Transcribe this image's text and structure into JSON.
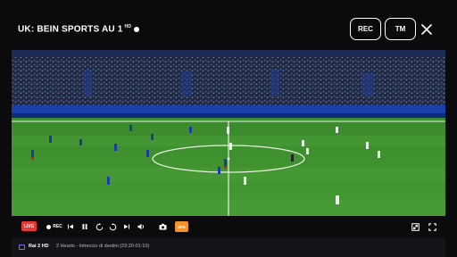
{
  "header": {
    "channel_title": "UK: BEIN SPORTS AU 1",
    "quality": "HD",
    "rec_label": "REC",
    "tm_label": "TM"
  },
  "controls": {
    "live_badge": "LIVE",
    "rec_label": "REC",
    "badge_label": "ZPK"
  },
  "now_playing": {
    "channel": "Rai 2 HD",
    "program": "2 Hearts - Intreccio di destini (23:20-01:10)"
  },
  "colors": {
    "live": "#e53935",
    "accent_badge": "#f4932a",
    "channel_icon": "#7b6cff",
    "pitch": "#3f8f2f"
  }
}
